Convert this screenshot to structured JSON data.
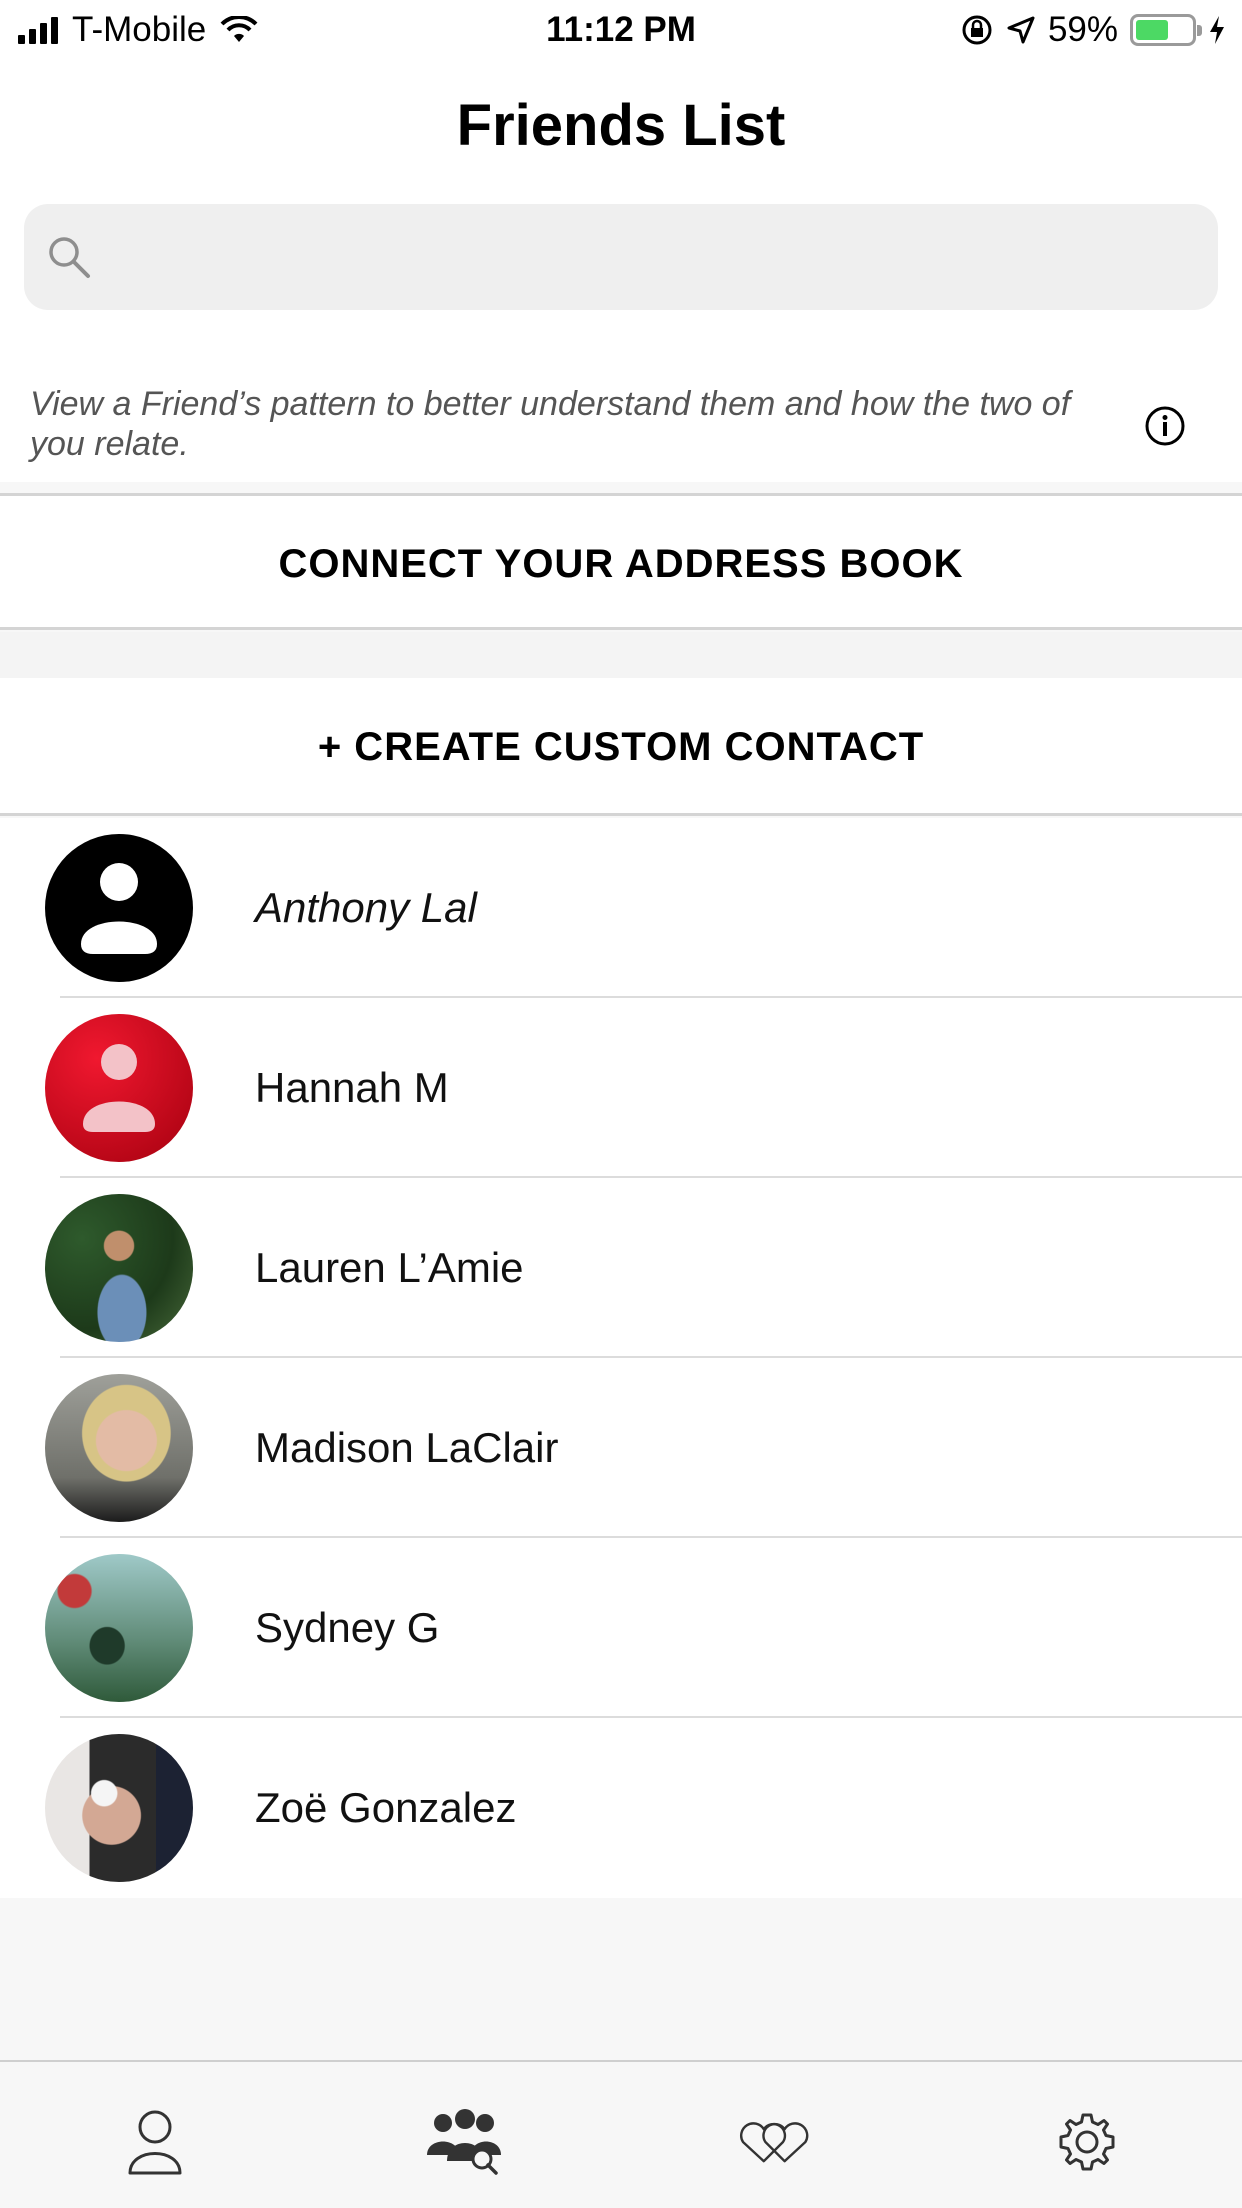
{
  "status_bar": {
    "carrier": "T-Mobile",
    "time": "11:12 PM",
    "battery_percent": "59%",
    "battery_level": 0.59,
    "icons": [
      "signal-icon",
      "wifi-icon",
      "orientation-lock-icon",
      "location-icon",
      "battery-icon",
      "charging-icon"
    ]
  },
  "header": {
    "title": "Friends List"
  },
  "search": {
    "placeholder": "",
    "value": ""
  },
  "hint": {
    "text": "View a Friend’s pattern to better understand them and how the two of you relate."
  },
  "actions": {
    "connect_label": "CONNECT YOUR ADDRESS BOOK",
    "create_label": "+ CREATE CUSTOM CONTACT"
  },
  "friends": [
    {
      "name": "Anthony Lal",
      "avatar": "default-black"
    },
    {
      "name": "Hannah M",
      "avatar": "default-red"
    },
    {
      "name": "Lauren L’Amie",
      "avatar": "photo"
    },
    {
      "name": "Madison LaClair",
      "avatar": "photo"
    },
    {
      "name": "Sydney G",
      "avatar": "photo"
    },
    {
      "name": "Zoë Gonzalez",
      "avatar": "photo"
    }
  ],
  "tabbar": {
    "tabs": [
      "profile-tab",
      "friends-tab",
      "relationships-tab",
      "settings-tab"
    ],
    "active": "friends-tab"
  },
  "colors": {
    "accent_red": "#d0021b",
    "battery_green": "#4cd964",
    "text": "#111111",
    "muted": "#555555"
  }
}
